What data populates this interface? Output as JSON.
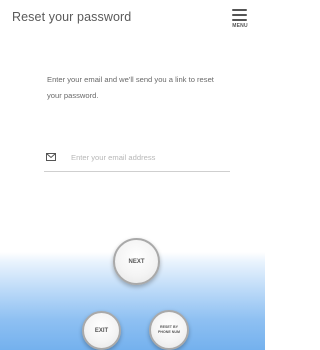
{
  "header": {
    "title": "Reset your password",
    "menu_label": "MENU"
  },
  "description": "Enter your email and we'll send you a link to reset your password.",
  "email": {
    "value": "",
    "placeholder": "Enter your email address",
    "icon": "envelope-icon"
  },
  "buttons": {
    "next_label": "NEXT",
    "exit_label": "EXIT",
    "reset_phone_label": "RESET BY PHONE NUM"
  },
  "colors": {
    "gradient_bottom": "#74b1ee",
    "button_border": "#a9a9a9",
    "text": "#5a5a5a"
  }
}
